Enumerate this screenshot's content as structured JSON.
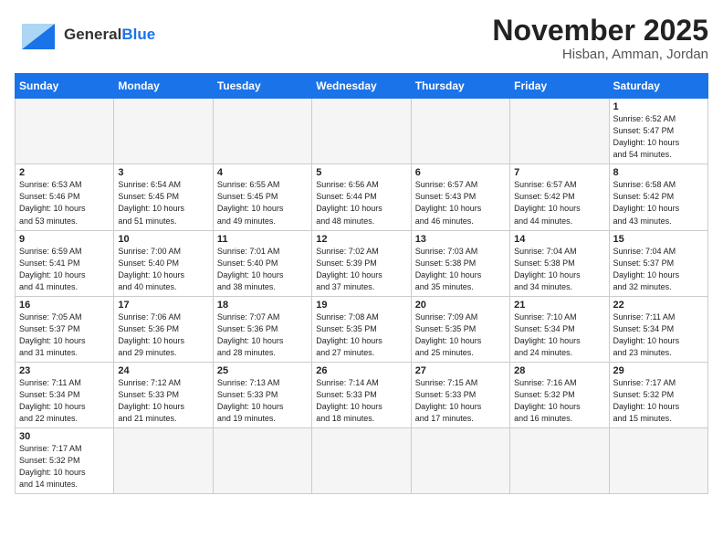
{
  "header": {
    "logo_general": "General",
    "logo_blue": "Blue",
    "title": "November 2025",
    "subtitle": "Hisban, Amman, Jordan"
  },
  "days_of_week": [
    "Sunday",
    "Monday",
    "Tuesday",
    "Wednesday",
    "Thursday",
    "Friday",
    "Saturday"
  ],
  "weeks": [
    [
      {
        "day": "",
        "info": ""
      },
      {
        "day": "",
        "info": ""
      },
      {
        "day": "",
        "info": ""
      },
      {
        "day": "",
        "info": ""
      },
      {
        "day": "",
        "info": ""
      },
      {
        "day": "",
        "info": ""
      },
      {
        "day": "1",
        "info": "Sunrise: 6:52 AM\nSunset: 5:47 PM\nDaylight: 10 hours\nand 54 minutes."
      }
    ],
    [
      {
        "day": "2",
        "info": "Sunrise: 6:53 AM\nSunset: 5:46 PM\nDaylight: 10 hours\nand 53 minutes."
      },
      {
        "day": "3",
        "info": "Sunrise: 6:54 AM\nSunset: 5:45 PM\nDaylight: 10 hours\nand 51 minutes."
      },
      {
        "day": "4",
        "info": "Sunrise: 6:55 AM\nSunset: 5:45 PM\nDaylight: 10 hours\nand 49 minutes."
      },
      {
        "day": "5",
        "info": "Sunrise: 6:56 AM\nSunset: 5:44 PM\nDaylight: 10 hours\nand 48 minutes."
      },
      {
        "day": "6",
        "info": "Sunrise: 6:57 AM\nSunset: 5:43 PM\nDaylight: 10 hours\nand 46 minutes."
      },
      {
        "day": "7",
        "info": "Sunrise: 6:57 AM\nSunset: 5:42 PM\nDaylight: 10 hours\nand 44 minutes."
      },
      {
        "day": "8",
        "info": "Sunrise: 6:58 AM\nSunset: 5:42 PM\nDaylight: 10 hours\nand 43 minutes."
      }
    ],
    [
      {
        "day": "9",
        "info": "Sunrise: 6:59 AM\nSunset: 5:41 PM\nDaylight: 10 hours\nand 41 minutes."
      },
      {
        "day": "10",
        "info": "Sunrise: 7:00 AM\nSunset: 5:40 PM\nDaylight: 10 hours\nand 40 minutes."
      },
      {
        "day": "11",
        "info": "Sunrise: 7:01 AM\nSunset: 5:40 PM\nDaylight: 10 hours\nand 38 minutes."
      },
      {
        "day": "12",
        "info": "Sunrise: 7:02 AM\nSunset: 5:39 PM\nDaylight: 10 hours\nand 37 minutes."
      },
      {
        "day": "13",
        "info": "Sunrise: 7:03 AM\nSunset: 5:38 PM\nDaylight: 10 hours\nand 35 minutes."
      },
      {
        "day": "14",
        "info": "Sunrise: 7:04 AM\nSunset: 5:38 PM\nDaylight: 10 hours\nand 34 minutes."
      },
      {
        "day": "15",
        "info": "Sunrise: 7:04 AM\nSunset: 5:37 PM\nDaylight: 10 hours\nand 32 minutes."
      }
    ],
    [
      {
        "day": "16",
        "info": "Sunrise: 7:05 AM\nSunset: 5:37 PM\nDaylight: 10 hours\nand 31 minutes."
      },
      {
        "day": "17",
        "info": "Sunrise: 7:06 AM\nSunset: 5:36 PM\nDaylight: 10 hours\nand 29 minutes."
      },
      {
        "day": "18",
        "info": "Sunrise: 7:07 AM\nSunset: 5:36 PM\nDaylight: 10 hours\nand 28 minutes."
      },
      {
        "day": "19",
        "info": "Sunrise: 7:08 AM\nSunset: 5:35 PM\nDaylight: 10 hours\nand 27 minutes."
      },
      {
        "day": "20",
        "info": "Sunrise: 7:09 AM\nSunset: 5:35 PM\nDaylight: 10 hours\nand 25 minutes."
      },
      {
        "day": "21",
        "info": "Sunrise: 7:10 AM\nSunset: 5:34 PM\nDaylight: 10 hours\nand 24 minutes."
      },
      {
        "day": "22",
        "info": "Sunrise: 7:11 AM\nSunset: 5:34 PM\nDaylight: 10 hours\nand 23 minutes."
      }
    ],
    [
      {
        "day": "23",
        "info": "Sunrise: 7:11 AM\nSunset: 5:34 PM\nDaylight: 10 hours\nand 22 minutes."
      },
      {
        "day": "24",
        "info": "Sunrise: 7:12 AM\nSunset: 5:33 PM\nDaylight: 10 hours\nand 21 minutes."
      },
      {
        "day": "25",
        "info": "Sunrise: 7:13 AM\nSunset: 5:33 PM\nDaylight: 10 hours\nand 19 minutes."
      },
      {
        "day": "26",
        "info": "Sunrise: 7:14 AM\nSunset: 5:33 PM\nDaylight: 10 hours\nand 18 minutes."
      },
      {
        "day": "27",
        "info": "Sunrise: 7:15 AM\nSunset: 5:33 PM\nDaylight: 10 hours\nand 17 minutes."
      },
      {
        "day": "28",
        "info": "Sunrise: 7:16 AM\nSunset: 5:32 PM\nDaylight: 10 hours\nand 16 minutes."
      },
      {
        "day": "29",
        "info": "Sunrise: 7:17 AM\nSunset: 5:32 PM\nDaylight: 10 hours\nand 15 minutes."
      }
    ],
    [
      {
        "day": "30",
        "info": "Sunrise: 7:17 AM\nSunset: 5:32 PM\nDaylight: 10 hours\nand 14 minutes."
      },
      {
        "day": "",
        "info": ""
      },
      {
        "day": "",
        "info": ""
      },
      {
        "day": "",
        "info": ""
      },
      {
        "day": "",
        "info": ""
      },
      {
        "day": "",
        "info": ""
      },
      {
        "day": "",
        "info": ""
      }
    ]
  ]
}
